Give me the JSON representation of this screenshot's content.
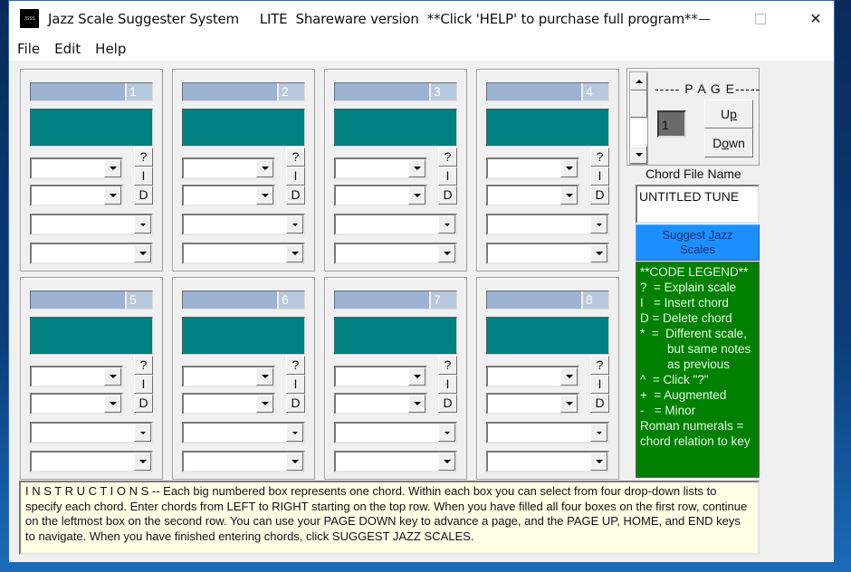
{
  "window": {
    "app_icon_text": "JSSS",
    "title": "Jazz Scale Suggester System     LITE  Shareware version  **Click 'HELP' to purchase full program**",
    "controls": {
      "minimize": "minimize",
      "maximize": "maximize",
      "close": "close"
    }
  },
  "menu": {
    "items": [
      "File",
      "Edit",
      "Help"
    ]
  },
  "chord_boxes": [
    {
      "number": "1",
      "combo1": "",
      "combo2": "",
      "combo3": "",
      "combo4": ""
    },
    {
      "number": "2",
      "combo1": "",
      "combo2": "",
      "combo3": "",
      "combo4": ""
    },
    {
      "number": "3",
      "combo1": "",
      "combo2": "",
      "combo3": "",
      "combo4": ""
    },
    {
      "number": "4",
      "combo1": "",
      "combo2": "",
      "combo3": "",
      "combo4": ""
    },
    {
      "number": "5",
      "combo1": "",
      "combo2": "",
      "combo3": "",
      "combo4": ""
    },
    {
      "number": "6",
      "combo1": "",
      "combo2": "",
      "combo3": "",
      "combo4": ""
    },
    {
      "number": "7",
      "combo1": "",
      "combo2": "",
      "combo3": "",
      "combo4": ""
    },
    {
      "number": "8",
      "combo1": "",
      "combo2": "",
      "combo3": "",
      "combo4": ""
    }
  ],
  "chord_box_buttons": {
    "explain": "?",
    "insert": "I",
    "delete": "D"
  },
  "page": {
    "label": "----- P A G E-----",
    "current": "1",
    "up_label_pre": "U",
    "up_label_accel": "p",
    "down_label_pre": "D",
    "down_label_accel": "o",
    "down_label_post": "wn"
  },
  "chord_file": {
    "label": "Chord File Name",
    "value": "UNTITLED TUNE"
  },
  "suggest_button": {
    "line1_pre": "Suggest ",
    "line1_accel": "J",
    "line1_post": "azz",
    "line2": "Scales"
  },
  "legend": {
    "lines": [
      "**CODE LEGEND**",
      "?  = Explain scale",
      "I   = Insert chord",
      "D = Delete chord",
      "*  =  Different scale,",
      "        but same notes",
      "        as previous",
      "^  = Click \"?\"",
      "+  = Augmented",
      "-   = Minor",
      "Roman numerals =",
      "chord relation to key"
    ]
  },
  "instructions": "I N S T R U C T I O N S --  Each big numbered box represents one chord.  Within each box you can select from four drop-down lists to specify each chord.   Enter chords from LEFT to RIGHT starting on the top row. When you have filled all  four boxes on the first row, continue on the leftmost box on the second row.  You can use your PAGE DOWN key to advance a page, and the PAGE UP, HOME, and END keys to navigate.   When you have finished entering chords, click SUGGEST JAZZ SCALES.",
  "colors": {
    "teal_display": "#008080",
    "header_bar": "#9cb3d4",
    "suggest_button": "#1e8fff",
    "legend_bg": "#008000",
    "instructions_bg": "#ffffe6",
    "page_indicator": "#6a6a6a"
  }
}
